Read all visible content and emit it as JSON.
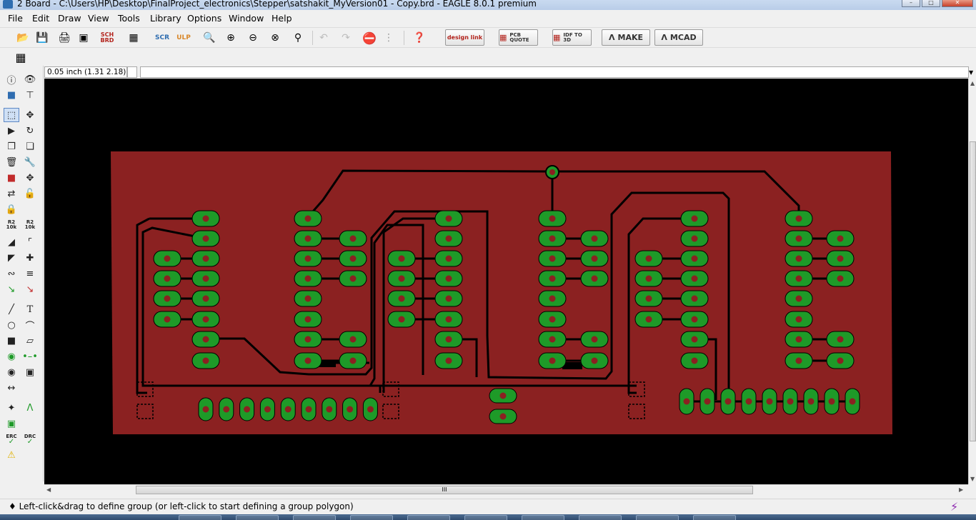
{
  "window": {
    "title": "2 Board - C:\\Users\\HP\\Desktop\\FinalProject_electronics\\Stepper\\satshakit_MyVersion01 - Copy.brd - EAGLE 8.0.1 premium",
    "controls": [
      "minimize-icon",
      "maximize-icon",
      "close-icon"
    ]
  },
  "menu": [
    "File",
    "Edit",
    "Draw",
    "View",
    "Tools",
    "Library",
    "Options",
    "Window",
    "Help"
  ],
  "toolbar": {
    "icons": [
      "open-icon",
      "save-icon",
      "print-icon",
      "cam-icon",
      "sch-brd-icon",
      "library-icon",
      "script-icon",
      "ulp-icon",
      "zoom-fit-icon",
      "zoom-in-icon",
      "zoom-out-icon",
      "zoom-select-icon",
      "zoom-area-icon",
      "undo-icon",
      "redo-icon",
      "stop-icon",
      "go-icon",
      "help-icon"
    ],
    "brand_buttons": {
      "design_link": "design link",
      "pcb_quote": "PCB QUOTE",
      "idf": "IDF TO 3D",
      "make": "MAKE",
      "mcad": "MCAD"
    },
    "grid_icon": "grid-icon"
  },
  "command": {
    "coordinates": "0.05 inch (1.31 2.18)",
    "input_value": ""
  },
  "left_tools": {
    "labels": {
      "name": "R2 10k",
      "value": "R2 10k",
      "erc": "ERC",
      "drc": "DRC",
      "text": "T"
    }
  },
  "status": {
    "message": "♦ Left-click&drag to define group (or left-click to start defining a group polygon)"
  },
  "scrollbar": {
    "grip": "III"
  },
  "colors": {
    "board_fill": "#8b2121",
    "pad": "#1e9a28",
    "via_hole": "#8b2121",
    "trace": "#000000",
    "canvas": "#000000"
  }
}
